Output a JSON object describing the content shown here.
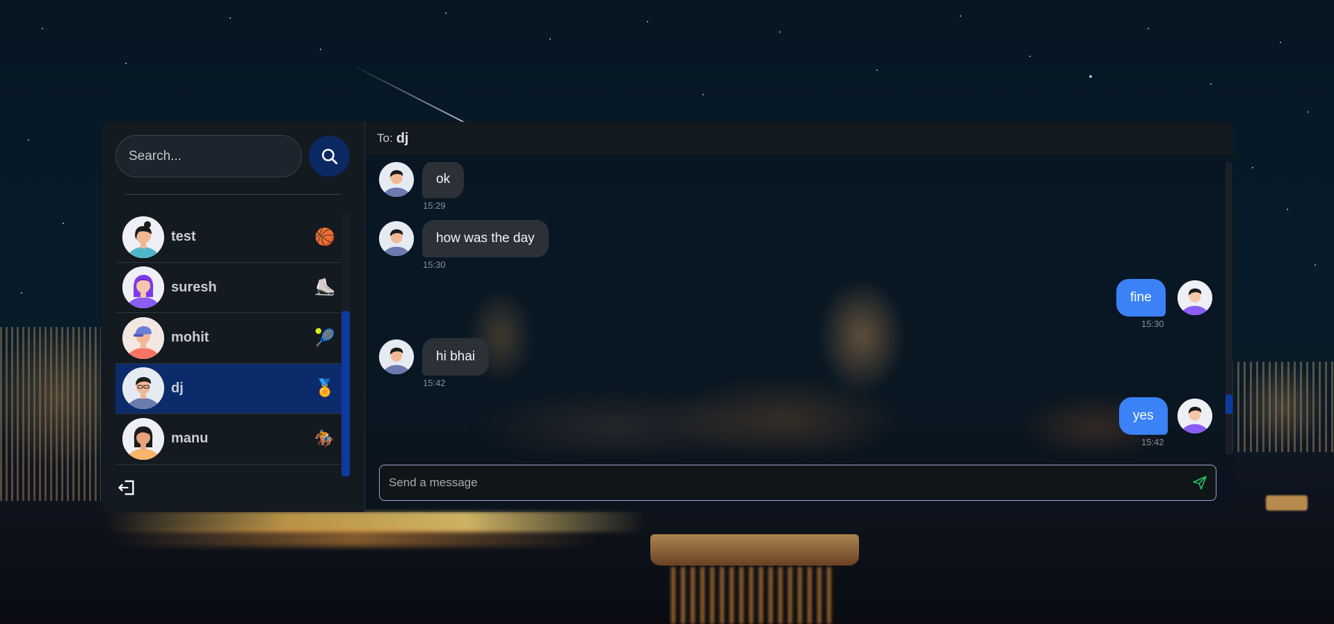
{
  "search": {
    "placeholder": "Search..."
  },
  "users": [
    {
      "name": "test",
      "emoji": "🏀",
      "avatar": "woman-dark-hair-icon",
      "selected": false
    },
    {
      "name": "suresh",
      "emoji": "⛸️",
      "avatar": "woman-purple-icon",
      "selected": false
    },
    {
      "name": "mohit",
      "emoji": "🎾",
      "avatar": "man-cap-icon",
      "selected": false
    },
    {
      "name": "dj",
      "emoji": "🏅",
      "avatar": "man-glasses-icon",
      "selected": true
    },
    {
      "name": "manu",
      "emoji": "🏇",
      "avatar": "woman-orange-icon",
      "selected": false
    }
  ],
  "chat": {
    "to_label": "To:",
    "to_name": "dj",
    "messages": [
      {
        "text": "ok",
        "time": "15:29",
        "direction": "in"
      },
      {
        "text": "how was the day",
        "time": "15:30",
        "direction": "in"
      },
      {
        "text": "fine",
        "time": "15:30",
        "direction": "out"
      },
      {
        "text": "hi bhai",
        "time": "15:42",
        "direction": "in"
      },
      {
        "text": "yes",
        "time": "15:42",
        "direction": "out"
      }
    ],
    "composer_placeholder": "Send a message"
  },
  "colors": {
    "accent": "#3b82f6",
    "selected_row": "#0c2b6b",
    "search_button": "#0b2a63",
    "send_icon": "#22c55e"
  }
}
